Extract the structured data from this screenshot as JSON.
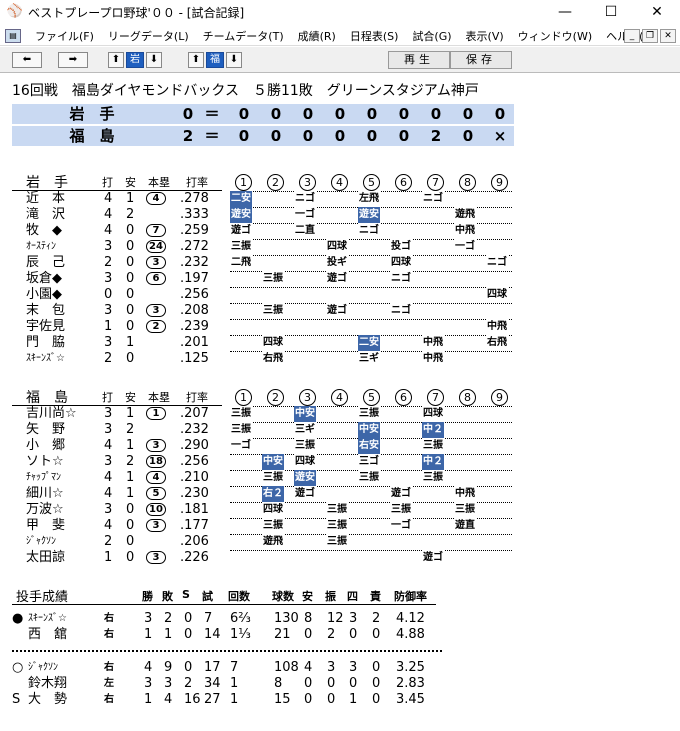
{
  "window": {
    "title": "ベストプレープロ野球'００ - [試合記録]",
    "min": "—",
    "max": "☐",
    "close": "✕"
  },
  "menu": [
    "ファイル(F)",
    "リーグデータ(L)",
    "チームデータ(T)",
    "成績(R)",
    "日程表(S)",
    "試合(G)",
    "表示(V)",
    "ウィンドウ(W)",
    "ヘルプ(H)"
  ],
  "toolbar": {
    "team1": "岩",
    "team2": "福",
    "replay": "再生",
    "save": "保存"
  },
  "game_info": "16回戦　福島ダイヤモンドバックス　５勝11敗　グリーンスタジアム神戸",
  "scoreboard": [
    {
      "team": "岩　手",
      "runs": "0",
      "eq": "＝",
      "innings": [
        "0",
        "0",
        "0",
        "0",
        "0",
        "0",
        "0",
        "0",
        "0"
      ]
    },
    {
      "team": "福　島",
      "runs": "2",
      "eq": "＝",
      "innings": [
        "0",
        "0",
        "0",
        "0",
        "0",
        "0",
        "2",
        "0",
        "×"
      ]
    }
  ],
  "columns": {
    "ab": "打",
    "h": "安",
    "hr": "本塁",
    "avg": "打率"
  },
  "inning_labels": [
    "1",
    "2",
    "3",
    "4",
    "5",
    "6",
    "7",
    "8",
    "9"
  ],
  "away": {
    "team": "岩　手",
    "players": [
      {
        "name": "近　本",
        "ab": "4",
        "h": "1",
        "hr": "4",
        "avg": ".278",
        "res": [
          {
            "i": 0,
            "t": "二安",
            "hit": true
          },
          {
            "i": 2,
            "t": "ニゴ"
          },
          {
            "i": 4,
            "t": "左飛"
          },
          {
            "i": 6,
            "t": "ニゴ"
          }
        ]
      },
      {
        "name": "滝　沢",
        "ab": "4",
        "h": "2",
        "hr": "",
        "avg": ".333",
        "res": [
          {
            "i": 0,
            "t": "遊安",
            "hit": true
          },
          {
            "i": 2,
            "t": "一ゴ"
          },
          {
            "i": 4,
            "t": "遊安",
            "hit": true
          },
          {
            "i": 7,
            "t": "遊飛"
          }
        ]
      },
      {
        "name": "牧　◆",
        "ab": "4",
        "h": "0",
        "hr": "7",
        "avg": ".259",
        "res": [
          {
            "i": 0,
            "t": "遊ゴ"
          },
          {
            "i": 2,
            "t": "二直"
          },
          {
            "i": 4,
            "t": "ニゴ"
          },
          {
            "i": 7,
            "t": "中飛"
          }
        ]
      },
      {
        "name": "ｵｰｽﾃｨﾝ",
        "ab": "3",
        "h": "0",
        "hr": "24",
        "avg": ".272",
        "res": [
          {
            "i": 0,
            "t": "三振"
          },
          {
            "i": 3,
            "t": "四球"
          },
          {
            "i": 5,
            "t": "投ゴ"
          },
          {
            "i": 7,
            "t": "一ゴ"
          }
        ]
      },
      {
        "name": "辰　己",
        "ab": "2",
        "h": "0",
        "hr": "3",
        "avg": ".232",
        "res": [
          {
            "i": 0,
            "t": "二飛"
          },
          {
            "i": 3,
            "t": "投ギ"
          },
          {
            "i": 5,
            "t": "四球"
          },
          {
            "i": 8,
            "t": "ニゴ"
          }
        ]
      },
      {
        "name": "坂倉◆",
        "ab": "3",
        "h": "0",
        "hr": "6",
        "avg": ".197",
        "res": [
          {
            "i": 1,
            "t": "三振"
          },
          {
            "i": 3,
            "t": "遊ゴ"
          },
          {
            "i": 5,
            "t": "ニゴ"
          }
        ]
      },
      {
        "name": "小園◆",
        "ab": "0",
        "h": "0",
        "hr": "",
        "avg": ".256",
        "res": [
          {
            "i": 8,
            "t": "四球"
          }
        ]
      },
      {
        "name": "末　包",
        "ab": "3",
        "h": "0",
        "hr": "3",
        "avg": ".208",
        "res": [
          {
            "i": 1,
            "t": "三振"
          },
          {
            "i": 3,
            "t": "遊ゴ"
          },
          {
            "i": 5,
            "t": "ニゴ"
          }
        ]
      },
      {
        "name": "宇佐見",
        "ab": "1",
        "h": "0",
        "hr": "2",
        "avg": ".239",
        "res": [
          {
            "i": 8,
            "t": "中飛"
          }
        ]
      },
      {
        "name": "門　脇",
        "ab": "3",
        "h": "1",
        "hr": "",
        "avg": ".201",
        "res": [
          {
            "i": 1,
            "t": "四球"
          },
          {
            "i": 4,
            "t": "二安",
            "hit": true
          },
          {
            "i": 6,
            "t": "中飛"
          },
          {
            "i": 8,
            "t": "右飛"
          }
        ]
      },
      {
        "name": "ｽｷｰﾝｽﾞ☆",
        "ab": "2",
        "h": "0",
        "hr": "",
        "avg": ".125",
        "res": [
          {
            "i": 1,
            "t": "右飛"
          },
          {
            "i": 4,
            "t": "三ギ"
          },
          {
            "i": 6,
            "t": "中飛"
          }
        ]
      }
    ]
  },
  "home": {
    "team": "福　島",
    "players": [
      {
        "name": "吉川尚☆",
        "ab": "3",
        "h": "1",
        "hr": "1",
        "avg": ".207",
        "res": [
          {
            "i": 0,
            "t": "三振"
          },
          {
            "i": 2,
            "t": "中安",
            "hit": true
          },
          {
            "i": 4,
            "t": "三振"
          },
          {
            "i": 6,
            "t": "四球"
          }
        ]
      },
      {
        "name": "矢　野",
        "ab": "3",
        "h": "2",
        "hr": "",
        "avg": ".232",
        "res": [
          {
            "i": 0,
            "t": "三振"
          },
          {
            "i": 2,
            "t": "三ギ"
          },
          {
            "i": 4,
            "t": "中安",
            "hit": true
          },
          {
            "i": 6,
            "t": "中２",
            "hit": true
          }
        ]
      },
      {
        "name": "小　郷",
        "ab": "4",
        "h": "1",
        "hr": "3",
        "avg": ".290",
        "res": [
          {
            "i": 0,
            "t": "一ゴ"
          },
          {
            "i": 2,
            "t": "三振"
          },
          {
            "i": 4,
            "t": "右安",
            "hit": true
          },
          {
            "i": 6,
            "t": "三振"
          }
        ]
      },
      {
        "name": "ソト☆",
        "ab": "3",
        "h": "2",
        "hr": "18",
        "avg": ".256",
        "res": [
          {
            "i": 1,
            "t": "中安",
            "hit": true
          },
          {
            "i": 2,
            "t": "四球"
          },
          {
            "i": 4,
            "t": "三ゴ"
          },
          {
            "i": 6,
            "t": "中２",
            "hit": true
          }
        ]
      },
      {
        "name": "ﾁｬｯﾌﾟﾏﾝ",
        "ab": "4",
        "h": "1",
        "hr": "4",
        "avg": ".210",
        "res": [
          {
            "i": 1,
            "t": "三振"
          },
          {
            "i": 2,
            "t": "遊安",
            "hit": true
          },
          {
            "i": 4,
            "t": "三振"
          },
          {
            "i": 6,
            "t": "三振"
          }
        ]
      },
      {
        "name": "細川☆",
        "ab": "4",
        "h": "1",
        "hr": "5",
        "avg": ".230",
        "res": [
          {
            "i": 1,
            "t": "右２",
            "hit": true
          },
          {
            "i": 2,
            "t": "遊ゴ"
          },
          {
            "i": 5,
            "t": "遊ゴ"
          },
          {
            "i": 7,
            "t": "中飛"
          }
        ]
      },
      {
        "name": "万波☆",
        "ab": "3",
        "h": "0",
        "hr": "10",
        "avg": ".181",
        "res": [
          {
            "i": 1,
            "t": "四球"
          },
          {
            "i": 3,
            "t": "三振"
          },
          {
            "i": 5,
            "t": "三振"
          },
          {
            "i": 7,
            "t": "三振"
          }
        ]
      },
      {
        "name": "甲　斐",
        "ab": "4",
        "h": "0",
        "hr": "3",
        "avg": ".177",
        "res": [
          {
            "i": 1,
            "t": "三振"
          },
          {
            "i": 3,
            "t": "三振"
          },
          {
            "i": 5,
            "t": "一ゴ"
          },
          {
            "i": 7,
            "t": "遊直"
          }
        ]
      },
      {
        "name": "ｼﾞｬｸｿﾝ",
        "ab": "2",
        "h": "0",
        "hr": "",
        "avg": ".206",
        "res": [
          {
            "i": 1,
            "t": "遊飛"
          },
          {
            "i": 3,
            "t": "三振"
          }
        ]
      },
      {
        "name": "太田諒",
        "ab": "1",
        "h": "0",
        "hr": "3",
        "avg": ".226",
        "res": [
          {
            "i": 6,
            "t": "遊ゴ"
          }
        ]
      }
    ]
  },
  "pitching": {
    "title": "投手成績",
    "headers": [
      "勝",
      "敗",
      "S",
      "試",
      "回数",
      "球数",
      "安",
      "振",
      "四",
      "責",
      "防御率"
    ],
    "away": [
      {
        "mark": "●",
        "name": "ｽｷｰﾝｽﾞ☆",
        "hand": "右",
        "w": "3",
        "l": "2",
        "s": "0",
        "g": "7",
        "ip": "6⅔",
        "np": "130",
        "h": "8",
        "k": "12",
        "bb": "3",
        "er": "2",
        "era": "4.12"
      },
      {
        "mark": "",
        "name": "西　舘",
        "hand": "右",
        "w": "1",
        "l": "1",
        "s": "0",
        "g": "14",
        "ip": "1⅓",
        "np": "21",
        "h": "0",
        "k": "2",
        "bb": "0",
        "er": "0",
        "era": "4.88"
      }
    ],
    "home": [
      {
        "mark": "○",
        "name": "ｼﾞｬｸｿﾝ",
        "hand": "右",
        "w": "4",
        "l": "9",
        "s": "0",
        "g": "17",
        "ip": "7",
        "np": "108",
        "h": "4",
        "k": "3",
        "bb": "3",
        "er": "0",
        "era": "3.25"
      },
      {
        "mark": "",
        "name": "鈴木翔",
        "hand": "左",
        "w": "3",
        "l": "3",
        "s": "2",
        "g": "34",
        "ip": "1",
        "np": "8",
        "h": "0",
        "k": "0",
        "bb": "0",
        "er": "0",
        "era": "2.83"
      },
      {
        "mark": "S",
        "name": "大　勢",
        "hand": "右",
        "w": "1",
        "l": "4",
        "s": "16",
        "g": "27",
        "ip": "1",
        "np": "15",
        "h": "0",
        "k": "0",
        "bb": "1",
        "er": "0",
        "era": "3.45"
      }
    ]
  }
}
